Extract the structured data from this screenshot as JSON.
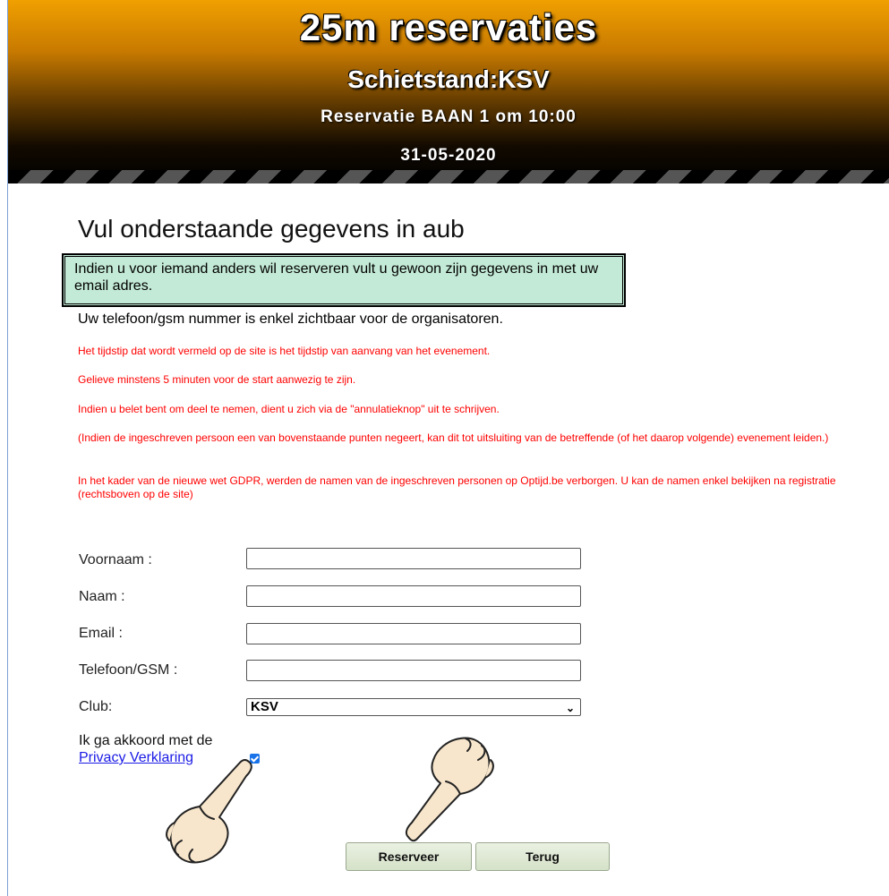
{
  "header": {
    "title": "25m reservaties",
    "location": "Schietstand:KSV",
    "reservation": "Reservatie BAAN 1 om 10:00",
    "date": "31-05-2020",
    "colors": {
      "top": "#f0a000",
      "bottom": "#000000"
    }
  },
  "main": {
    "heading": "Vul onderstaande gegevens in aub",
    "notice": "Indien u voor iemand anders wil reserveren vult u gewoon zijn gegevens in met uw email adres.",
    "phone_note": "Uw telefoon/gsm nummer is enkel zichtbaar voor de organisatoren.",
    "rules": [
      "Het tijdstip dat wordt vermeld op de site is het tijdstip van aanvang van het evenement.",
      "Gelieve minstens 5 minuten voor de start aanwezig te zijn.",
      "Indien u belet bent om deel te nemen, dient u zich via de \"annulatieknop\" uit te schrijven.",
      "(Indien de ingeschreven persoon een van bovenstaande punten negeert, kan dit tot uitsluiting van de betreffende (of het daarop volgende) evenement leiden.)",
      "In het kader van de nieuwe wet GDPR, werden de namen van de ingeschreven personen op Optijd.be verborgen. U kan de namen enkel bekijken na registratie (rechtsboven op de site)"
    ]
  },
  "form": {
    "firstname_label": "Voornaam :",
    "lastname_label": "Naam :",
    "email_label": "Email :",
    "phone_label": "Telefoon/GSM :",
    "club_label": "Club:",
    "firstname_value": "",
    "lastname_value": "",
    "email_value": "",
    "phone_value": "",
    "club_value": "KSV",
    "agree_text": "Ik ga akkoord met de",
    "privacy_link": "Privacy Verklaring",
    "agree_checked": true
  },
  "buttons": {
    "reserve": "Reserveer",
    "back": "Terug"
  }
}
